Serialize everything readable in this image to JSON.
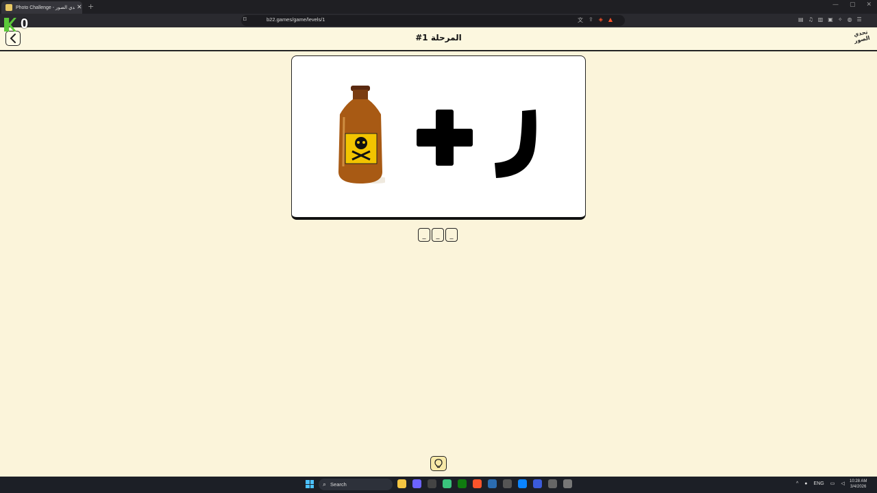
{
  "browser": {
    "tab_title": "Photo Challenge - تحدي الصور",
    "tab_close": "✕",
    "new_tab": "+",
    "url": "b22.games/game/levels/1",
    "badge_count": "0"
  },
  "header": {
    "title": "المرحلة 1#",
    "logo_text": "تحدي الصور"
  },
  "puzzle": {
    "slots": [
      "_",
      "_",
      "_"
    ],
    "plus_color": "#000000",
    "bottle_color": "#b5651d",
    "label_color": "#f2c400"
  },
  "taskbar": {
    "search_label": "Search",
    "language": "ENG",
    "time": "10:28 AM",
    "date": "3/4/2026"
  }
}
